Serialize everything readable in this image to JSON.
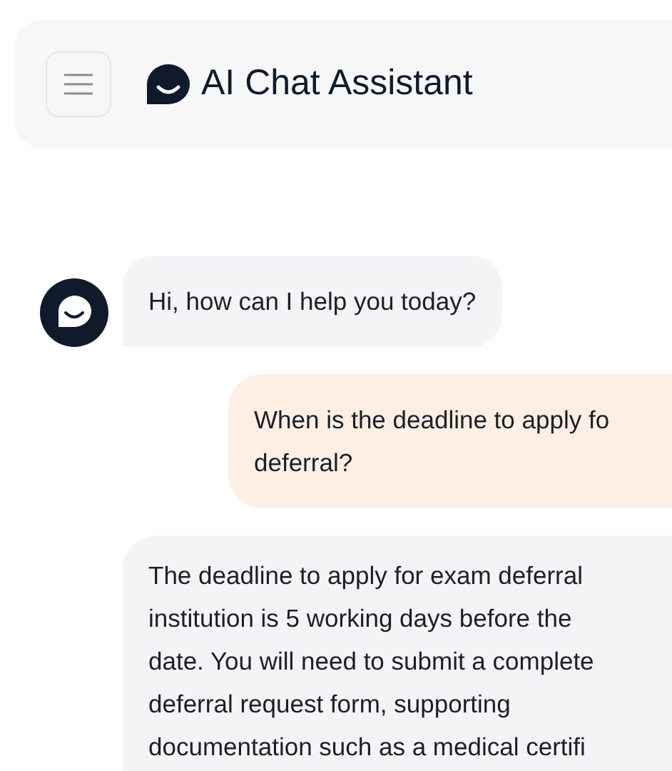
{
  "header": {
    "title": "AI Chat Assistant"
  },
  "messages": [
    {
      "kind": "bot",
      "avatar": true,
      "lines": [
        "Hi, how can I help you today?"
      ]
    },
    {
      "kind": "user",
      "avatar": false,
      "lines": [
        "When is the deadline to apply fo",
        "deferral?"
      ]
    },
    {
      "kind": "bot",
      "avatar": false,
      "lines": [
        "The deadline to apply for exam deferral",
        "institution is 5 working days before the",
        "date. You will need to submit a complete",
        "deferral request form, supporting",
        "documentation such as a medical certifi"
      ]
    }
  ]
}
